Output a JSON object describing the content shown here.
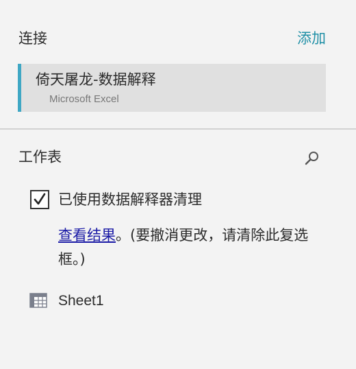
{
  "connections": {
    "header": "连接",
    "add_label": "添加",
    "items": [
      {
        "name": "倚天屠龙-数据解释",
        "type": "Microsoft Excel"
      }
    ]
  },
  "worksheets": {
    "header": "工作表",
    "search_icon": "search-icon",
    "interpreter": {
      "checked": true,
      "label": "已使用数据解释器清理",
      "view_results_link": "查看结果",
      "note_rest": "。(要撤消更改，请清除此复选框。)"
    },
    "sheets": [
      {
        "name": "Sheet1",
        "icon": "table-icon"
      }
    ]
  },
  "colors": {
    "accent": "#1f8fa6",
    "selection_bar": "#3fa7c4",
    "link": "#1a1aa6",
    "background": "#f3f3f3"
  }
}
